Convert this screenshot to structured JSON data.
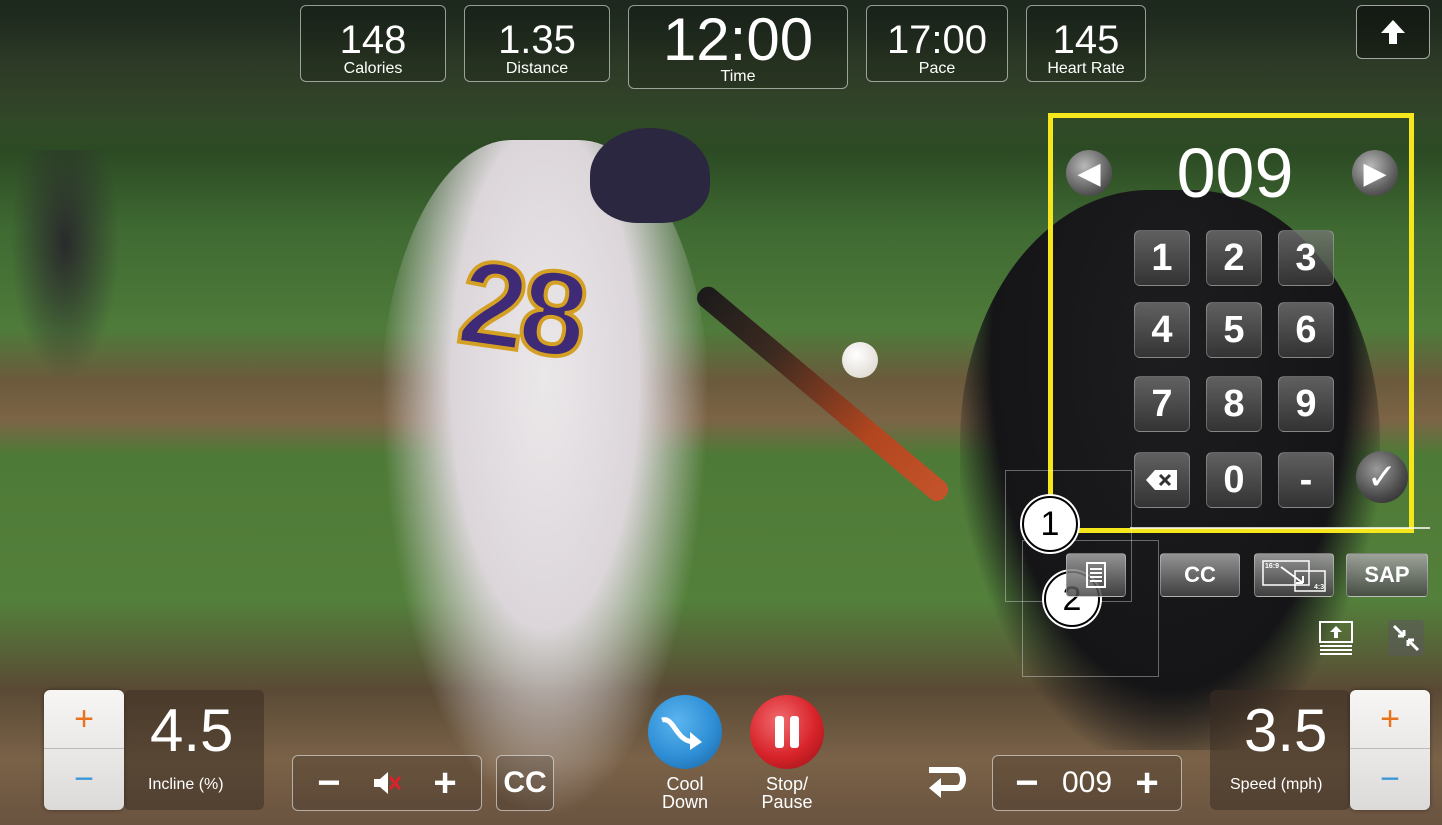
{
  "stats": [
    {
      "value": "148",
      "label": "Calories"
    },
    {
      "value": "1.35",
      "label": "Distance"
    },
    {
      "value": "12:00",
      "label": "Time"
    },
    {
      "value": "17:00",
      "label": "Pace"
    },
    {
      "value": "145",
      "label": "Heart Rate"
    }
  ],
  "keypad": {
    "channel": "009",
    "keys": [
      "1",
      "2",
      "3",
      "4",
      "5",
      "6",
      "7",
      "8",
      "9",
      "0",
      "-"
    ]
  },
  "callouts": [
    "1",
    "2"
  ],
  "media": {
    "cc_label": "CC",
    "sap_label": "SAP",
    "aspect_small": "16:9",
    "aspect_alt": "4:3"
  },
  "incline": {
    "value": "4.5",
    "label": "Incline (%)",
    "plus": "+",
    "minus": "−"
  },
  "volume": {
    "minus": "−",
    "plus": "+"
  },
  "cc_bottom": "CC",
  "cooldown": {
    "label_line1": "Cool",
    "label_line2": "Down"
  },
  "pause": {
    "label_line1": "Stop/",
    "label_line2": "Pause"
  },
  "channel_bar": {
    "minus": "−",
    "value": "009",
    "plus": "+"
  },
  "speed": {
    "value": "3.5",
    "label": "Speed (mph)",
    "plus": "+",
    "minus": "−"
  },
  "colors": {
    "highlight": "#f6e71c",
    "plus": "#e8731e",
    "minus": "#3a97d8",
    "cooldown": "#2f8fd6",
    "pause": "#d8232a"
  }
}
